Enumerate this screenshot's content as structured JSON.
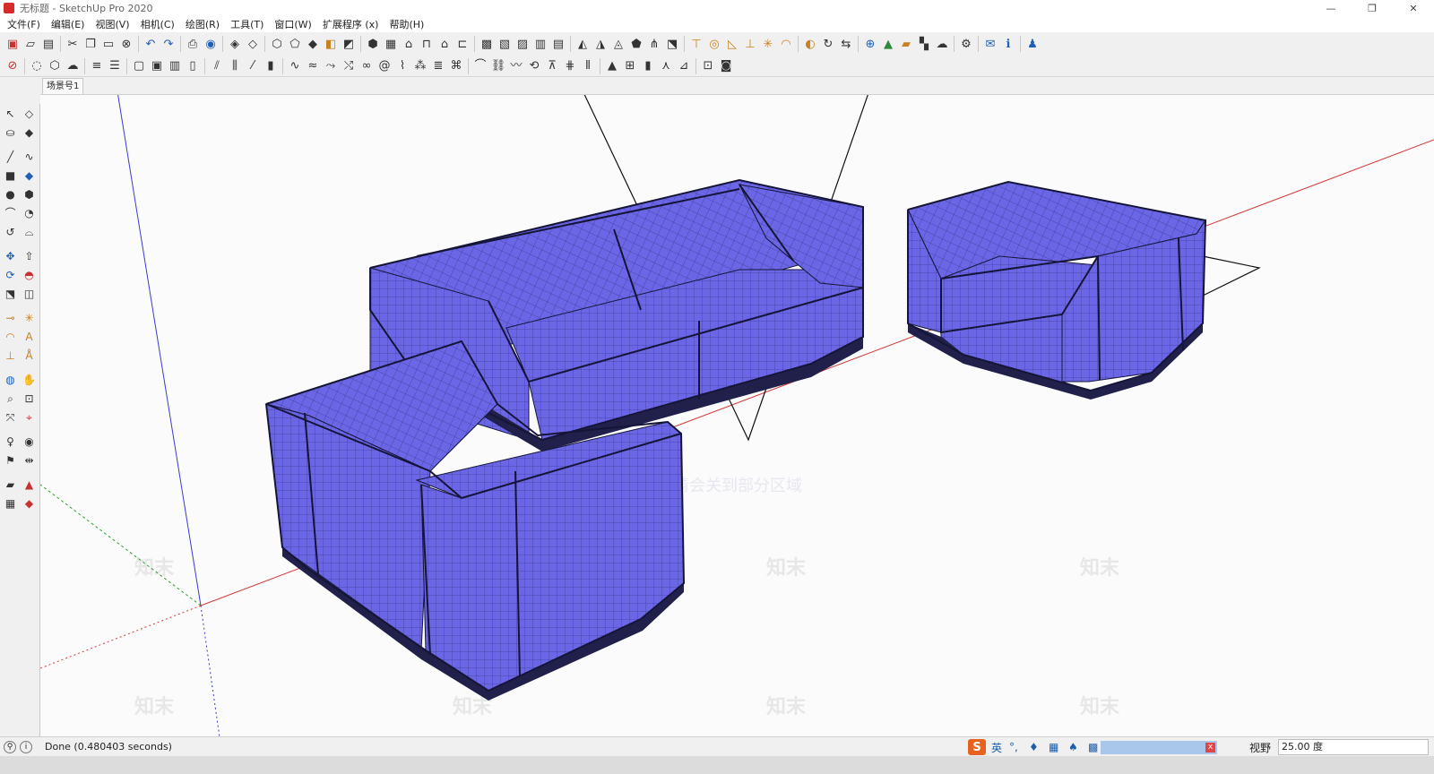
{
  "window": {
    "title": "无标题 - SketchUp Pro 2020",
    "minimize": "—",
    "maximize": "❐",
    "close": "✕"
  },
  "menu": [
    "文件(F)",
    "编辑(E)",
    "视图(V)",
    "相机(C)",
    "绘图(R)",
    "工具(T)",
    "窗口(W)",
    "扩展程序 (x)",
    "帮助(H)"
  ],
  "toolbar1": [
    "new-icon",
    "open-icon",
    "save-icon",
    "|",
    "cut-icon",
    "copy-icon",
    "paste-icon",
    "erase-icon",
    "|",
    "undo-icon",
    "redo-icon",
    "|",
    "print-icon",
    "model-info-icon",
    "|",
    "xray-icon",
    "backedge-icon",
    "|",
    "wireframe-icon",
    "hidden-line-icon",
    "shaded-icon",
    "textured-icon",
    "monochrome-icon",
    "|",
    "iso-icon",
    "top-icon",
    "front-icon",
    "right-icon",
    "back-icon",
    "left-icon",
    "|",
    "component-icon",
    "group-icon",
    "solid-union-icon",
    "solid-subtract-icon",
    "solid-trim-icon",
    "|",
    "sandbox-contour-icon",
    "sandbox-scratch-icon",
    "sandbox-smoove-icon",
    "sandbox-stamp-icon",
    "sandbox-drape-icon",
    "sandbox-detail-icon",
    "|",
    "section-plane-icon",
    "section-fill-icon",
    "section-cut-icon",
    "axes-icon",
    "dimension-icon",
    "protractor-icon",
    "|",
    "warehouse-icon",
    "extension-icon",
    "layout-icon",
    "|",
    "add-location-icon",
    "terrain-icon",
    "photo-texture-icon",
    "checker-icon",
    "cloud-icon",
    "|",
    "settings-icon",
    "|",
    "mail-icon",
    "info-icon",
    "|",
    "account-icon"
  ],
  "toolbar2": [
    "select-all-icon",
    "|",
    "lasso-icon",
    "group-select-icon",
    "cloud-select-icon",
    "|",
    "align-icon",
    "distribute-icon",
    "|",
    "window-icon",
    "frame-icon",
    "panel-icon",
    "lock-icon",
    "|",
    "stair-icon",
    "rail-icon",
    "line-tool-icon",
    "bars-icon",
    "|",
    "curve-icon",
    "rope-icon",
    "bend-icon",
    "twist-icon",
    "loop-icon",
    "spiral-icon",
    "wire-icon",
    "dots-icon",
    "stack-icon",
    "knot-icon",
    "|",
    "arc-icon",
    "chain-icon",
    "wave-icon",
    "spin-icon",
    "stool-icon",
    "fence-icon",
    "column-icon",
    "|",
    "triangle-icon",
    "grid-icon",
    "cube-icon",
    "figure-icon",
    "brush-icon",
    "|",
    "render-icon",
    "sphere-icon"
  ],
  "scene": {
    "tab": "场景号1"
  },
  "lefttools": [
    "select-icon",
    "eraser-icon",
    "paint-bucket-icon",
    "eraser-pink-icon",
    "|",
    "pencil-icon",
    "freehand-icon",
    "rectangle-icon",
    "rotated-rect-icon",
    "circle-icon",
    "polygon-icon",
    "arc-icon",
    "pie-icon",
    "spiral-arc-icon",
    "arc-3pt-icon",
    "|",
    "move-icon",
    "push-pull-icon",
    "rotate-icon",
    "follow-me-icon",
    "scale-icon",
    "offset-icon",
    "|",
    "tape-icon",
    "dimension-icon",
    "protractor-icon",
    "text-icon",
    "axes-icon",
    "3d-text-icon",
    "|",
    "orbit-icon",
    "pan-icon",
    "zoom-icon",
    "zoom-window-icon",
    "zoom-extents-icon",
    "previous-view-icon",
    "|",
    "position-camera-icon",
    "look-around-icon",
    "walk-icon",
    "section-icon",
    "|",
    "sandbox-icon",
    "sandbox-red-icon",
    "layer-icon",
    "paint-red-icon"
  ],
  "status": {
    "text": "Done (0.480403 seconds)",
    "ime_brand": "S",
    "ime_lang": "英",
    "measure_label": "视野",
    "measure_value": "25.00 度"
  },
  "watermark": {
    "mark": "知末",
    "note": "水印保护区，此请会关到部分区域"
  },
  "model": {
    "fill": "#6a66e6",
    "edge": "#151538",
    "axis_red": "#d43b3b",
    "axis_green": "#2ba02b",
    "axis_blue": "#3a3ad0"
  }
}
